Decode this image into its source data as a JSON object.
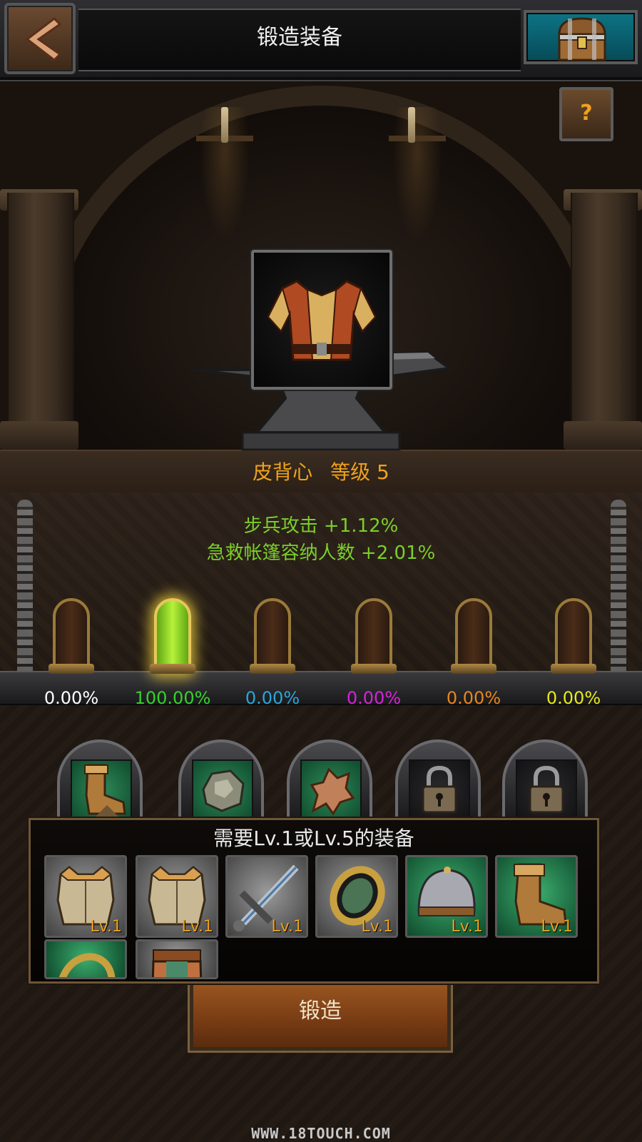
{
  "header": {
    "title": "锻造装备",
    "back_icon": "back-arrow-icon",
    "chest_icon": "treasure-chest-icon"
  },
  "help": {
    "label": "?"
  },
  "item": {
    "name": "皮背心",
    "level_text": "等级 5",
    "stats": [
      "步兵攻击 +1.12%",
      "急救帐篷容纳人数 +2.01%"
    ]
  },
  "quality_chances": [
    {
      "value": "0.00%",
      "color": "#ffffff",
      "active": false
    },
    {
      "value": "100.00%",
      "color": "#36d22a",
      "active": true
    },
    {
      "value": "0.00%",
      "color": "#2aa6d8",
      "active": false
    },
    {
      "value": "0.00%",
      "color": "#d424d8",
      "active": false
    },
    {
      "value": "0.00%",
      "color": "#e8861c",
      "active": false
    },
    {
      "value": "0.00%",
      "color": "#e8e81c",
      "active": false
    }
  ],
  "material_slots": [
    {
      "icon": "leather-boot-icon",
      "locked": false
    },
    {
      "icon": "iron-ore-icon",
      "locked": false
    },
    {
      "icon": "leather-hide-icon",
      "locked": false
    },
    {
      "icon": "padlock-icon",
      "locked": true
    },
    {
      "icon": "padlock-icon",
      "locked": true
    }
  ],
  "requirements": {
    "title": "需要Lv.1或Lv.5的装备",
    "items": [
      {
        "icon": "vest-icon",
        "level": "Lv.1",
        "bg": "gray"
      },
      {
        "icon": "vest-icon",
        "level": "Lv.1",
        "bg": "gray"
      },
      {
        "icon": "sword-icon",
        "level": "Lv.1",
        "bg": "gray"
      },
      {
        "icon": "ring-icon",
        "level": "Lv.1",
        "bg": "gray"
      },
      {
        "icon": "helmet-icon",
        "level": "Lv.1",
        "bg": "green"
      },
      {
        "icon": "boot-icon",
        "level": "Lv.1",
        "bg": "green"
      },
      {
        "icon": "ring-icon",
        "level": "",
        "bg": "green"
      },
      {
        "icon": "trousers-icon",
        "level": "",
        "bg": "gray"
      }
    ]
  },
  "forge_button": {
    "label": "锻造"
  },
  "watermark": "WWW.18TOUCH.COM",
  "colors": {
    "accent": "#f0a21c",
    "stat": "#7ccf2a"
  }
}
